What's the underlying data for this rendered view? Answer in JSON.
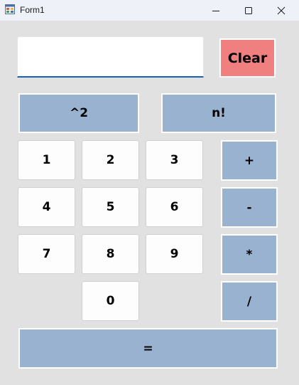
{
  "window": {
    "title": "Form1",
    "icon": "winforms-app-icon",
    "controls": {
      "minimize": "minimize-icon",
      "maximize": "maximize-icon",
      "close": "close-icon"
    }
  },
  "display": {
    "value": "",
    "placeholder": ""
  },
  "buttons": {
    "clear": "Clear",
    "square": "^2",
    "factorial": "n!",
    "one": "1",
    "two": "2",
    "three": "3",
    "four": "4",
    "five": "5",
    "six": "6",
    "seven": "7",
    "eight": "8",
    "nine": "9",
    "zero": "0",
    "plus": "+",
    "minus": "-",
    "multiply": "*",
    "divide": "/",
    "equals": "="
  },
  "colors": {
    "operator_button": "#98b2d0",
    "clear_button": "#f08080",
    "form_background": "#e1e1e1",
    "input_underline": "#1d5fb3"
  }
}
